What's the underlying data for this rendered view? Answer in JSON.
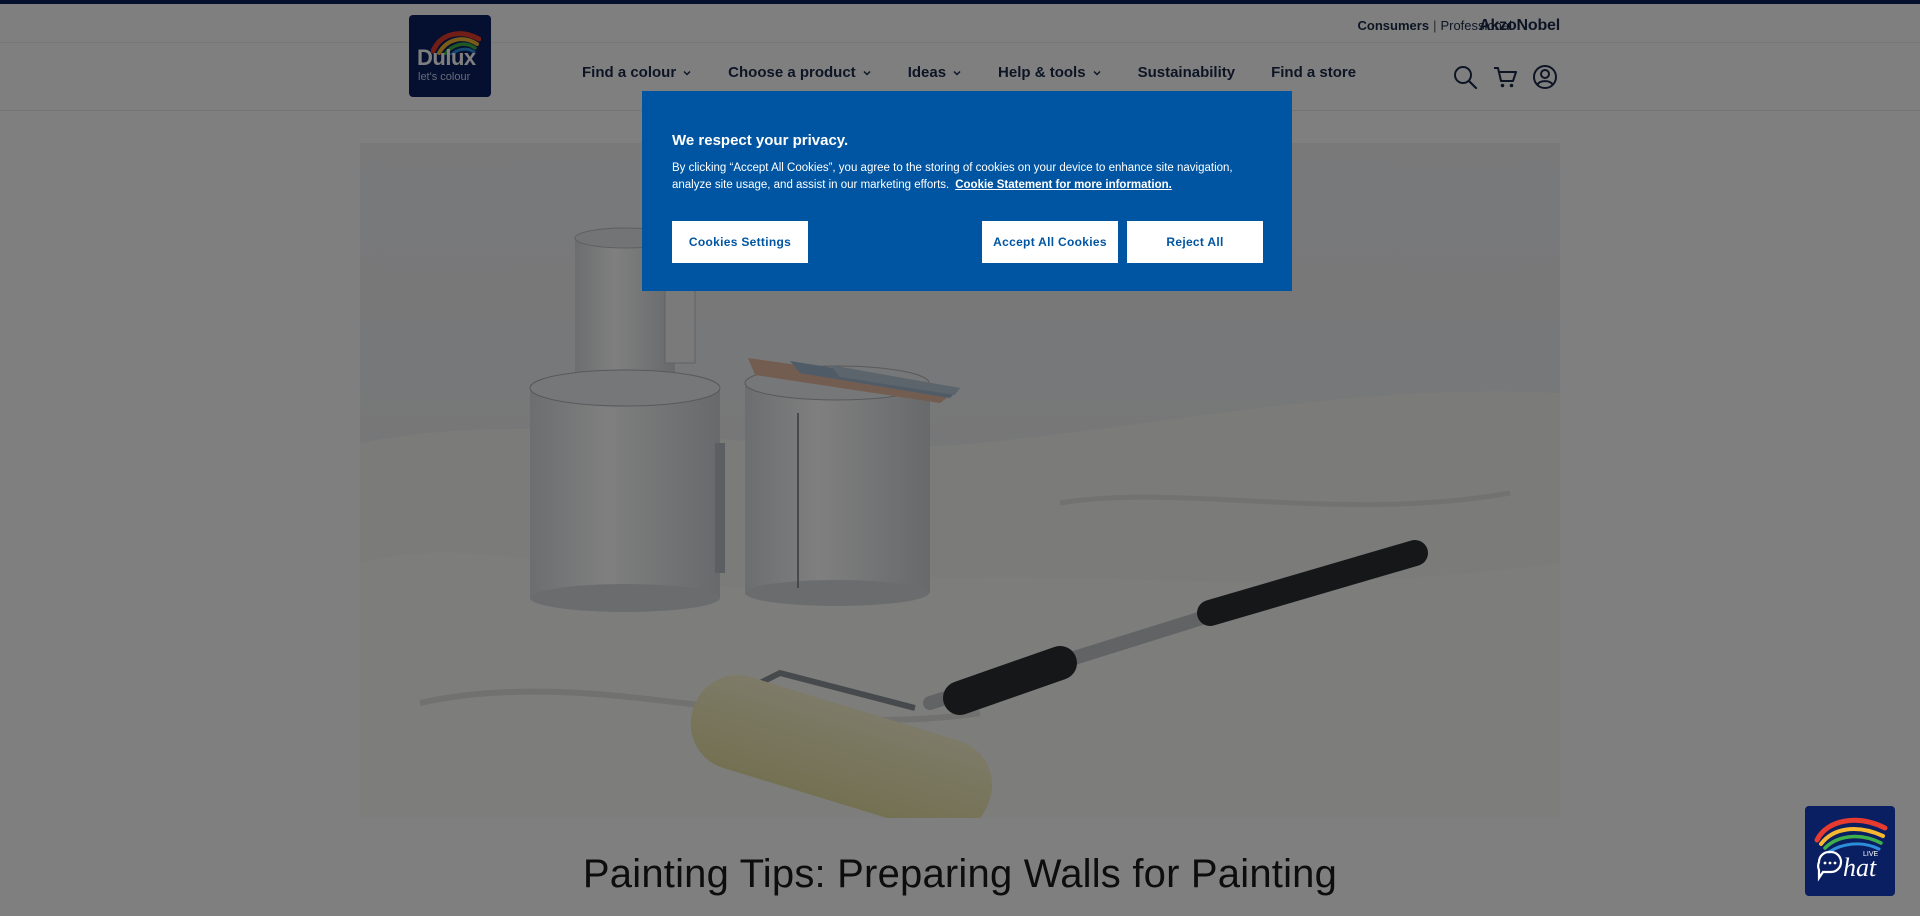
{
  "utility": {
    "consumers": "Consumers",
    "professional": "Professional",
    "akzonobel": "AkzoNobel"
  },
  "logo": {
    "brand": "Dulux",
    "tagline": "let's colour"
  },
  "nav": {
    "items": [
      {
        "label": "Find a colour",
        "has_dropdown": true
      },
      {
        "label": "Choose a product",
        "has_dropdown": true
      },
      {
        "label": "Ideas",
        "has_dropdown": true
      },
      {
        "label": "Help & tools",
        "has_dropdown": true
      },
      {
        "label": "Sustainability",
        "has_dropdown": false
      },
      {
        "label": "Find a store",
        "has_dropdown": false
      }
    ]
  },
  "icons": {
    "search": "search-icon",
    "cart": "cart-icon",
    "account": "account-icon"
  },
  "page": {
    "title": "Painting Tips: Preparing Walls for Painting"
  },
  "cookie": {
    "heading": "We respect your privacy.",
    "body": "By clicking “Accept All Cookies”, you agree to the storing of cookies on your device to enhance site navigation, analyze site usage, and assist in our marketing efforts.",
    "link": "Cookie Statement for more information.",
    "settings_label": "Cookies Settings",
    "accept_label": "Accept All Cookies",
    "reject_label": "Reject All"
  },
  "chat": {
    "label": "hat",
    "badge": "LIVE"
  },
  "colors": {
    "brand_navy": "#0a1f61",
    "cookie_blue": "#0055a2",
    "text_dark": "#1b2a4a"
  }
}
